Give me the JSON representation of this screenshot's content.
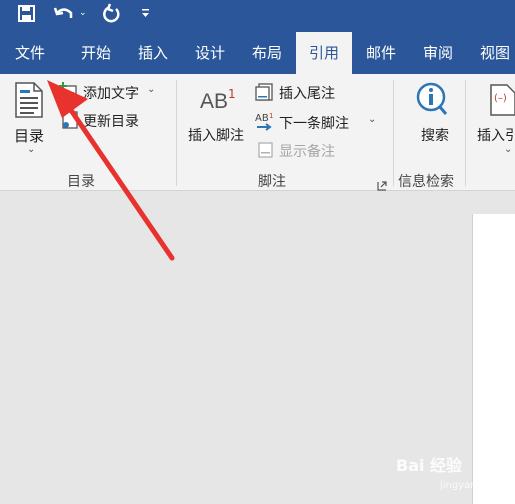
{
  "qat": {
    "save_icon": "save-icon",
    "undo_icon": "undo-icon",
    "redo_icon": "redo-icon",
    "customize_icon": "customize-qat-icon"
  },
  "tabs": [
    {
      "label": "文件"
    },
    {
      "label": "开始"
    },
    {
      "label": "插入"
    },
    {
      "label": "设计"
    },
    {
      "label": "布局"
    },
    {
      "label": "引用"
    },
    {
      "label": "邮件"
    },
    {
      "label": "审阅"
    },
    {
      "label": "视图"
    }
  ],
  "ribbon": {
    "toc": {
      "button": "目录",
      "add_text": "添加文字",
      "update_toc": "更新目录",
      "group": "目录"
    },
    "footnotes": {
      "insert_footnote": "插入脚注",
      "insert_endnote": "插入尾注",
      "next_footnote": "下一条脚注",
      "show_notes": "显示备注",
      "group": "脚注",
      "ab_glyph": "AB",
      "ab_sup": "1"
    },
    "research": {
      "search": "搜索",
      "group": "信息检索"
    },
    "citations": {
      "insert_citation": "插入引"
    }
  },
  "watermark": {
    "text": "Bai 经验",
    "url": "jingyan.baidu.com"
  },
  "colors": {
    "brand": "#2b579a",
    "arrow": "#e8322e",
    "accent_blue": "#2e75b6"
  }
}
